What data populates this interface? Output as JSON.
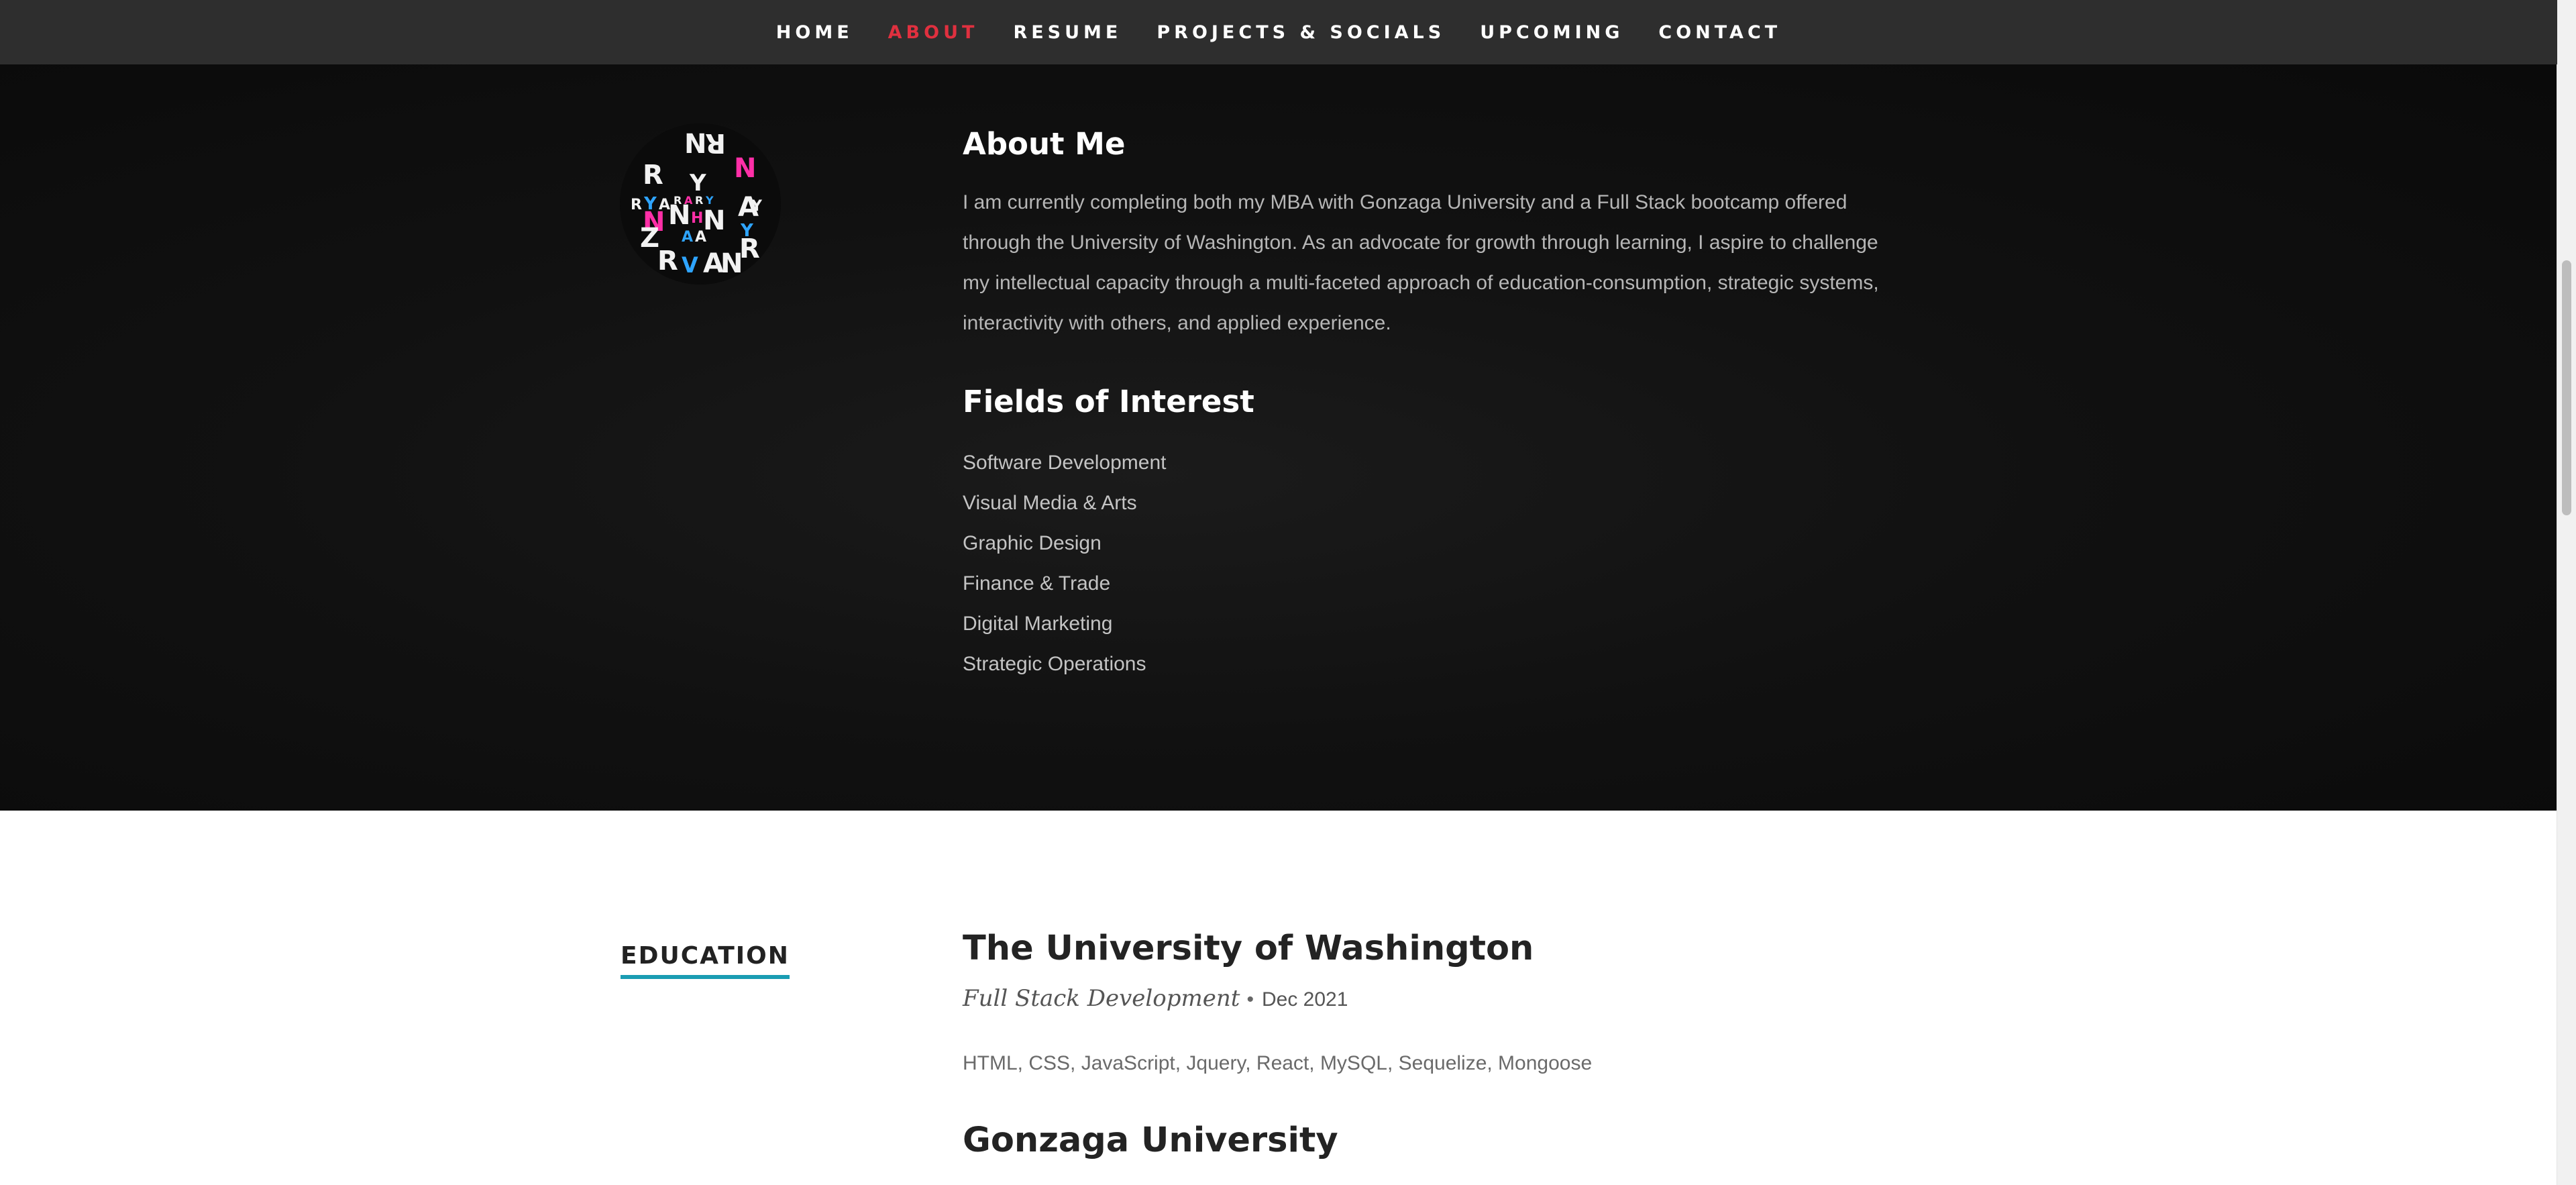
{
  "nav": {
    "items": [
      {
        "label": "HOME",
        "active": false
      },
      {
        "label": "ABOUT",
        "active": true
      },
      {
        "label": "RESUME",
        "active": false
      },
      {
        "label": "PROJECTS & SOCIALS",
        "active": false
      },
      {
        "label": "UPCOMING",
        "active": false
      },
      {
        "label": "CONTACT",
        "active": false
      }
    ],
    "active_color": "#e0303f"
  },
  "about": {
    "avatar": {
      "icon": "ryan-logo-avatar",
      "letters": "RYAN"
    },
    "title": "About Me",
    "bio": "I am currently completing both my MBA with Gonzaga University and a Full Stack bootcamp offered through the University of Washington. As an advocate for growth through learning, I aspire to challenge my intellectual capacity through a multi-faceted approach of education-consumption, strategic systems, interactivity with others, and applied experience.",
    "interests_title": "Fields of Interest",
    "interests": [
      "Software Development",
      "Visual Media & Arts",
      "Graphic Design",
      "Finance & Trade",
      "Digital Marketing",
      "Strategic Operations"
    ]
  },
  "education": {
    "label": "EDUCATION",
    "accent": "#1a9db3",
    "entries": [
      {
        "school": "The University of Washington",
        "degree": "Full Stack Development",
        "bullet": "•",
        "date": "Dec 2021",
        "skills": "HTML, CSS, JavaScript, Jquery, React, MySQL, Sequelize, Mongoose"
      },
      {
        "school": "Gonzaga University"
      }
    ]
  }
}
